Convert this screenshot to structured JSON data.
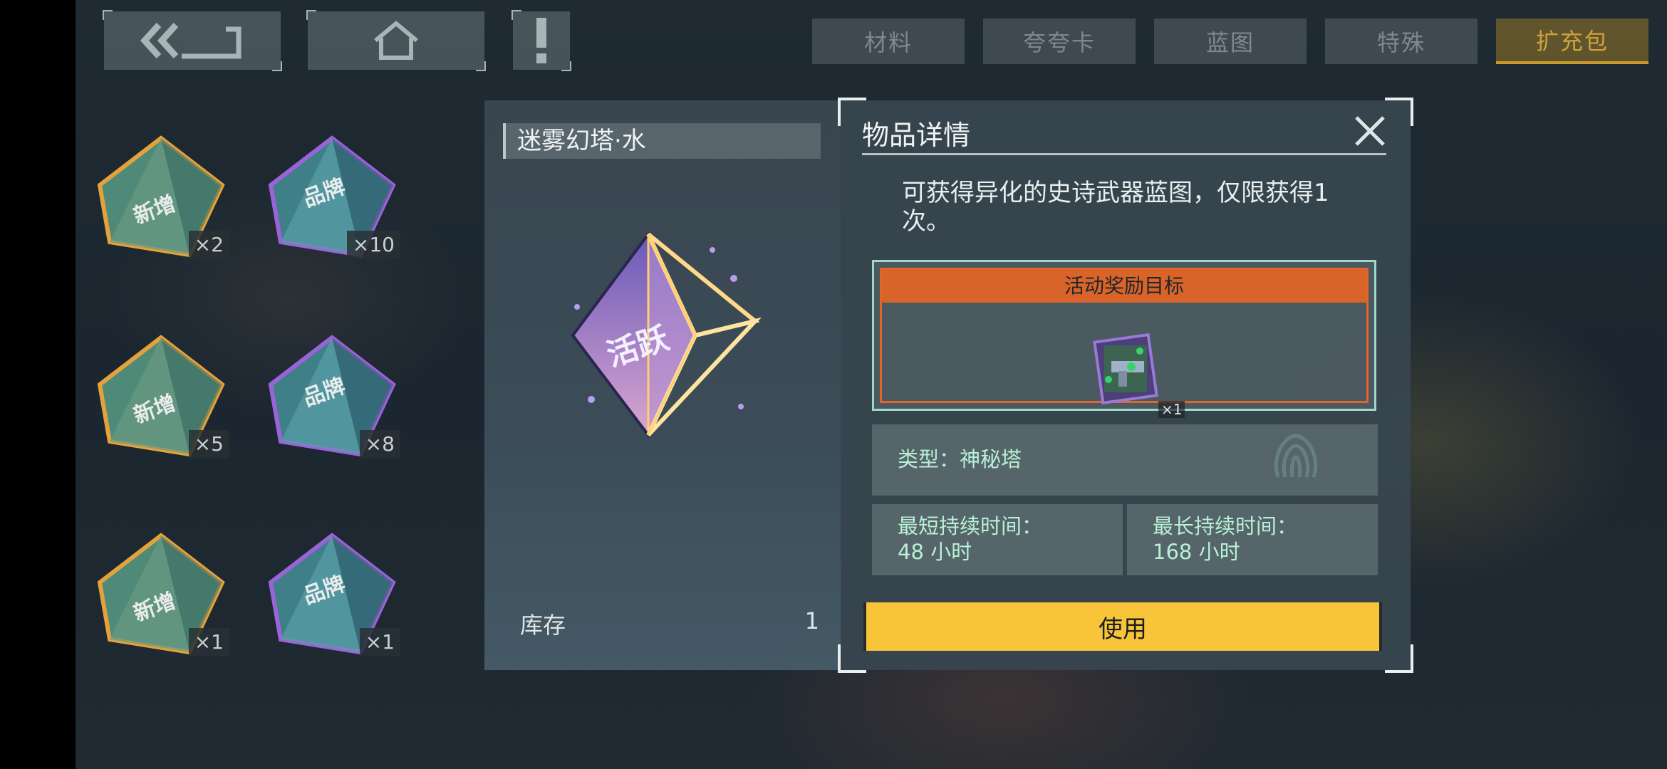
{
  "tabs": [
    {
      "label": "材料",
      "active": false
    },
    {
      "label": "夸夸卡",
      "active": false
    },
    {
      "label": "蓝图",
      "active": false
    },
    {
      "label": "特殊",
      "active": false
    },
    {
      "label": "扩充包",
      "active": true
    }
  ],
  "nav": {
    "back_icon": "double-chevron-back-icon",
    "home_icon": "home-icon",
    "alert_icon": "exclamation-icon"
  },
  "inventory": {
    "items": [
      {
        "label": "新增",
        "count": "×2",
        "style": "gold"
      },
      {
        "label": "品牌",
        "count": "×10",
        "style": "purple"
      },
      {
        "label": "新增",
        "count": "×5",
        "style": "gold"
      },
      {
        "label": "品牌",
        "count": "×8",
        "style": "purple"
      },
      {
        "label": "新增",
        "count": "×1",
        "style": "gold"
      },
      {
        "label": "品牌",
        "count": "×1",
        "style": "purple"
      }
    ]
  },
  "selected_item": {
    "name": "迷雾幻塔·水",
    "pyramid_label": "活跃",
    "stock_label": "库存",
    "stock_value": "1"
  },
  "details": {
    "title": "物品详情",
    "description": "可获得异化的史诗武器蓝图，仅限获得1次。",
    "reward_header": "活动奖励目标",
    "reward_count": "×1",
    "type_text": "类型：神秘塔",
    "min_duration_label": "最短持续时间：",
    "min_duration_value": "48 小时",
    "max_duration_label": "最长持续时间：",
    "max_duration_value": "168 小时",
    "use_button": "使用"
  },
  "colors": {
    "accent_gold": "#d1a13c",
    "use_button": "#f7c43a",
    "reward_header": "#d9642a",
    "info_text": "#b9f0d6"
  }
}
